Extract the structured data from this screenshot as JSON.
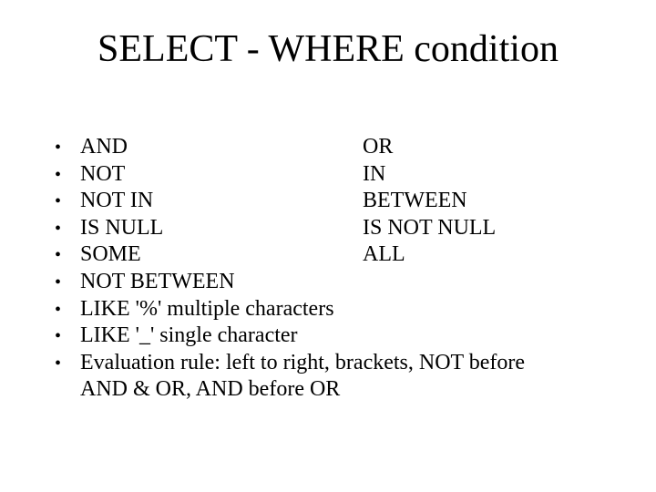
{
  "title": "SELECT - WHERE condition",
  "bullet_char": "•",
  "rows": [
    {
      "left": "AND",
      "right": "OR"
    },
    {
      "left": "NOT",
      "right": "IN"
    },
    {
      "left": "NOT IN",
      "right": "BETWEEN"
    },
    {
      "left": "IS NULL",
      "right": "IS NOT NULL"
    },
    {
      "left": "SOME",
      "right": "ALL"
    }
  ],
  "lines": [
    "NOT BETWEEN",
    "LIKE '%' multiple characters",
    "LIKE '_'  single character"
  ],
  "wrap": {
    "first": "Evaluation rule: left to right, brackets, NOT before",
    "cont": "AND & OR, AND before OR"
  }
}
